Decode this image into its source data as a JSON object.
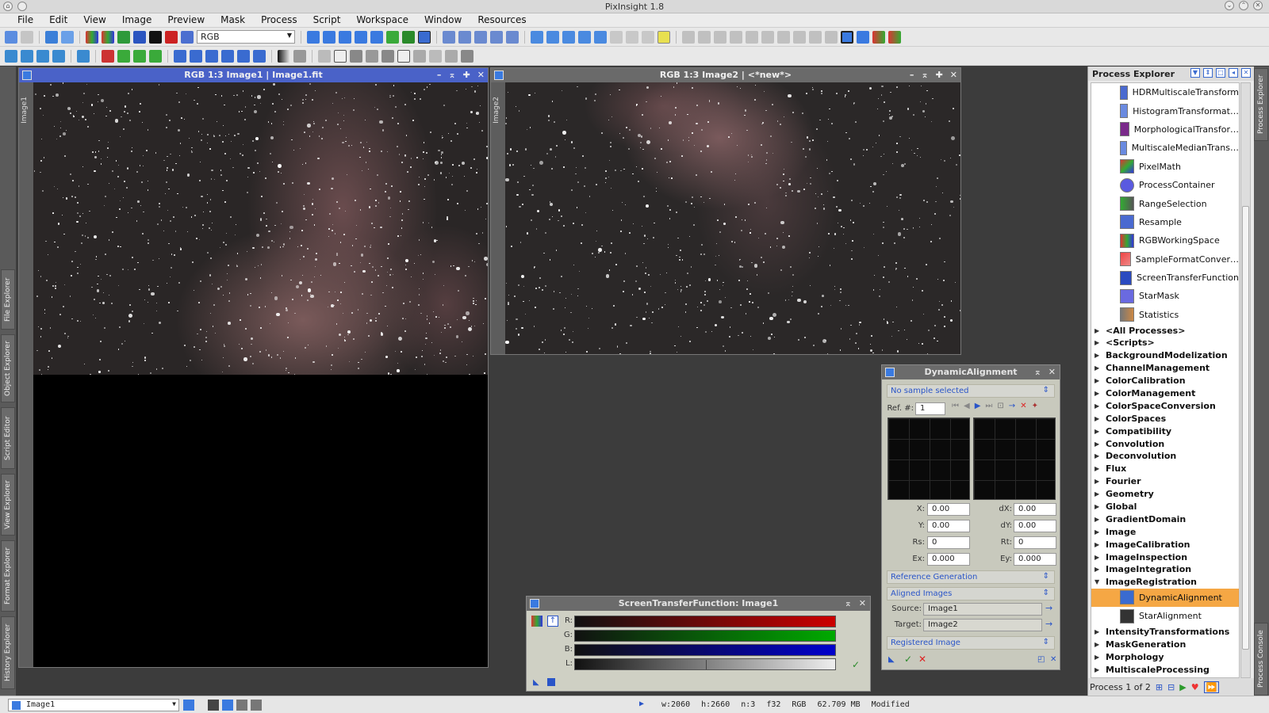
{
  "app": {
    "title": "PixInsight 1.8"
  },
  "menu": [
    "File",
    "Edit",
    "View",
    "Image",
    "Preview",
    "Mask",
    "Process",
    "Script",
    "Workspace",
    "Window",
    "Resources"
  ],
  "toolbar": {
    "color_space": "RGB"
  },
  "left_tabs": [
    "File Explorer",
    "Object Explorer",
    "Script Editor",
    "View Explorer",
    "Format Explorer",
    "History Explorer"
  ],
  "right_tabs": [
    "Process Explorer",
    "Process Console"
  ],
  "image1": {
    "title": "RGB 1:3 Image1 | Image1.fit",
    "side_label": "Image1"
  },
  "image2": {
    "title": "RGB 1:3 Image2 | <*new*>",
    "side_label": "Image2"
  },
  "process_explorer": {
    "title": "Process Explorer",
    "items": [
      "HDRMultiscaleTransform",
      "HistogramTransformat…",
      "MorphologicalTransfor…",
      "MultiscaleMedianTrans…",
      "PixelMath",
      "ProcessContainer",
      "RangeSelection",
      "Resample",
      "RGBWorkingSpace",
      "SampleFormatConver…",
      "ScreenTransferFunction",
      "StarMask",
      "Statistics"
    ],
    "categories": [
      "<All Processes>",
      "<Scripts>",
      "BackgroundModelization",
      "ChannelManagement",
      "ColorCalibration",
      "ColorManagement",
      "ColorSpaceConversion",
      "ColorSpaces",
      "Compatibility",
      "Convolution",
      "Deconvolution",
      "Flux",
      "Fourier",
      "Geometry",
      "Global",
      "GradientDomain",
      "Image",
      "ImageCalibration",
      "ImageInspection",
      "ImageIntegration",
      "ImageRegistration"
    ],
    "sub_items": [
      "DynamicAlignment",
      "StarAlignment"
    ],
    "tail_categories": [
      "IntensityTransformations",
      "MaskGeneration",
      "Morphology",
      "MultiscaleProcessing"
    ],
    "footer": "Process 1 of 2"
  },
  "dynamic_alignment": {
    "title": "DynamicAlignment",
    "no_sample": "No sample selected",
    "ref_label": "Ref. #:",
    "ref_value": "1",
    "x_label": "X:",
    "x": "0.00",
    "y_label": "Y:",
    "y": "0.00",
    "rs_label": "Rs:",
    "rs": "0",
    "ex_label": "Ex:",
    "ex": "0.000",
    "dx_label": "dX:",
    "dx": "0.00",
    "dy_label": "dY:",
    "dy": "0.00",
    "rt_label": "Rt:",
    "rt": "0",
    "ey_label": "Ey:",
    "ey": "0.000",
    "ref_gen": "Reference Generation",
    "aligned": "Aligned Images",
    "source_label": "Source:",
    "source": "Image1",
    "target_label": "Target:",
    "target": "Image2",
    "registered": "Registered Image"
  },
  "stf": {
    "title": "ScreenTransferFunction: Image1",
    "channels": [
      "R:",
      "G:",
      "B:",
      "L:"
    ]
  },
  "status": {
    "view": "Image1",
    "w": "w:2060",
    "h": "h:2660",
    "n": "n:3",
    "fmt": "f32",
    "space": "RGB",
    "size": "62.709 MB",
    "state": "Modified"
  }
}
